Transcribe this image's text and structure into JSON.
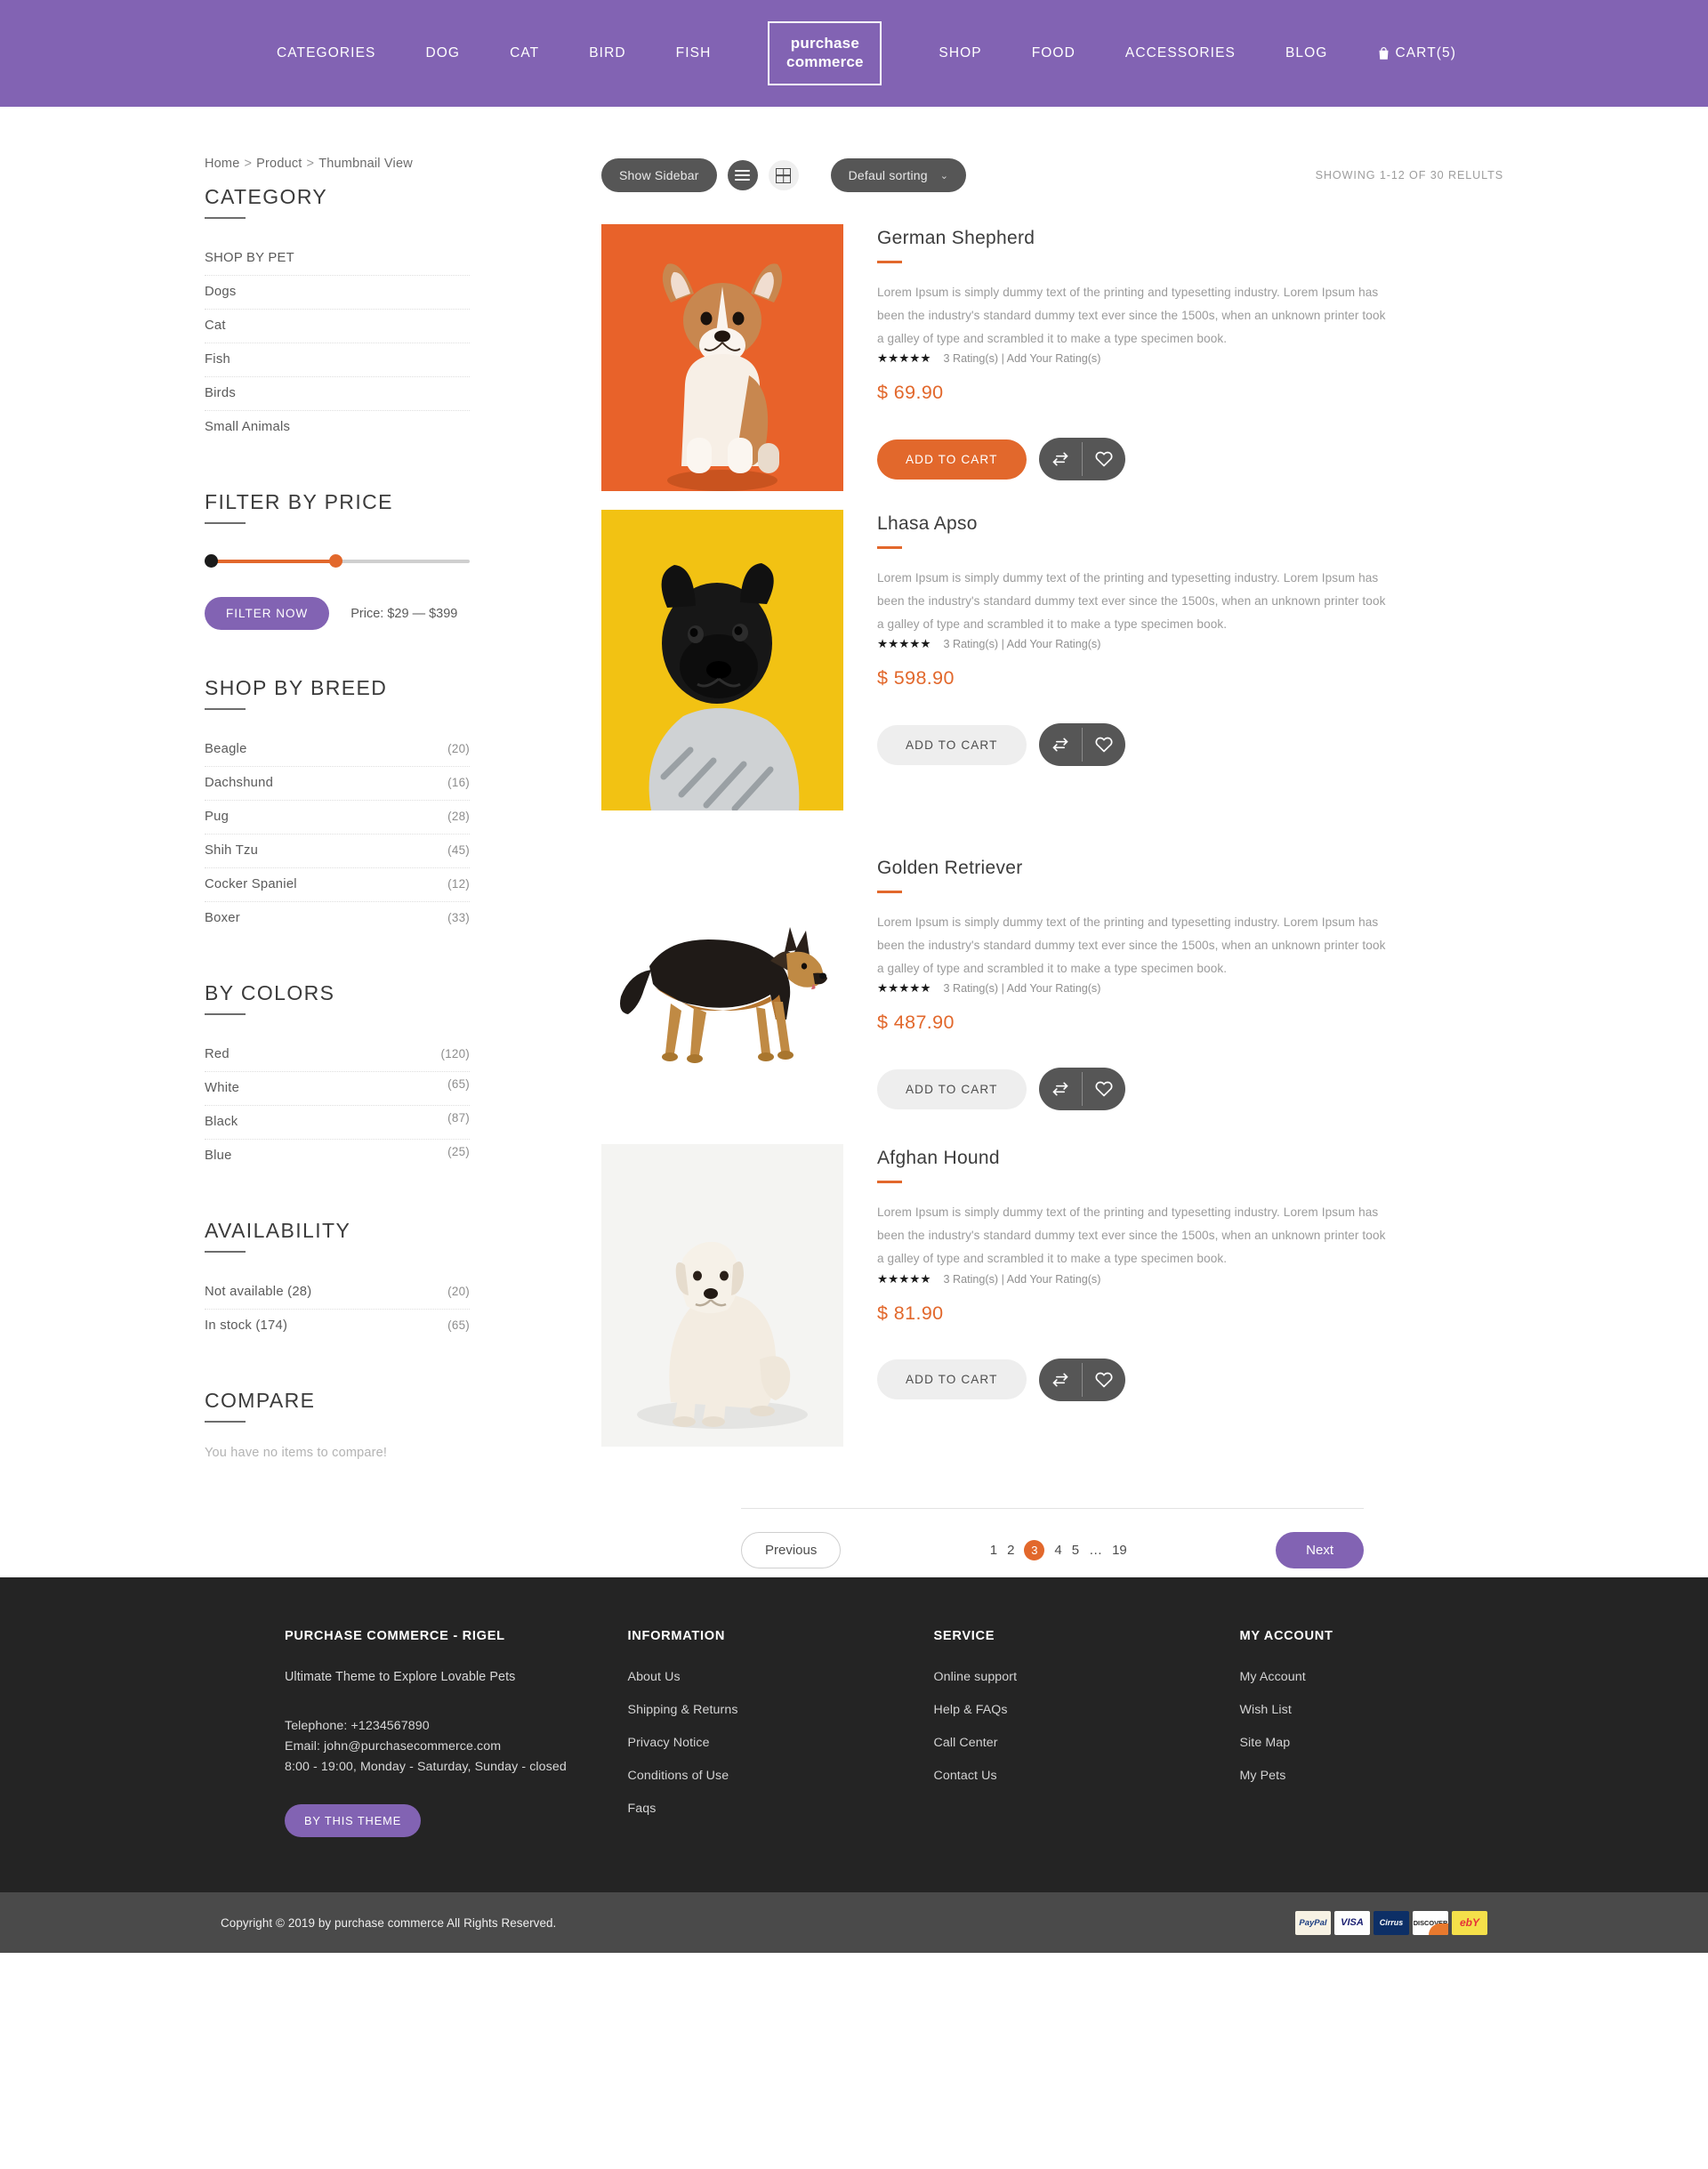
{
  "header": {
    "nav_left": [
      "CATEGORIES",
      "DOG",
      "CAT",
      "BIRD",
      "FISH"
    ],
    "logo_line1": "purchase",
    "logo_line2": "commerce",
    "nav_right": [
      "SHOP",
      "FOOD",
      "ACCESSORIES",
      "BLOG"
    ],
    "cart_label": "CART(5)",
    "cart_icon": "cart-icon",
    "brand_color": "#8263b3"
  },
  "breadcrumb": {
    "items": [
      "Home",
      "Product",
      "Thumbnail View"
    ],
    "separator": ">"
  },
  "sidebar": {
    "category": {
      "title": "CATEGORY",
      "items": [
        {
          "label": "SHOP BY PET",
          "count": ""
        },
        {
          "label": "Dogs",
          "count": ""
        },
        {
          "label": "Cat",
          "count": ""
        },
        {
          "label": "Fish",
          "count": ""
        },
        {
          "label": "Birds",
          "count": ""
        },
        {
          "label": "Small Animals",
          "count": ""
        }
      ]
    },
    "price": {
      "title": "FILTER BY PRICE",
      "filter_button": "FILTER NOW",
      "range_label": "Price: $29 — $399",
      "min": 29,
      "max": 399,
      "knob_low_color": "#1b1b1b",
      "knob_high_color": "#e2682c"
    },
    "breed": {
      "title": "SHOP BY BREED",
      "items": [
        {
          "label": "Beagle",
          "count": "(20)"
        },
        {
          "label": "Dachshund",
          "count": "(16)"
        },
        {
          "label": "Pug",
          "count": "(28)"
        },
        {
          "label": "Shih Tzu",
          "count": "(45)"
        },
        {
          "label": "Cocker Spaniel",
          "count": "(12)"
        },
        {
          "label": "Boxer",
          "count": "(33)"
        }
      ]
    },
    "colors": {
      "title": "BY COLORS",
      "items": [
        {
          "label": "Red",
          "count": "(120)"
        },
        {
          "label": "White",
          "count": "(65)"
        },
        {
          "label": "Black",
          "count": "(87)"
        },
        {
          "label": "Blue",
          "count": "(25)"
        }
      ]
    },
    "availability": {
      "title": "AVAILABILITY",
      "items": [
        {
          "label": "Not available (28)",
          "count": "(20)"
        },
        {
          "label": "In stock (174)",
          "count": "(65)"
        }
      ]
    },
    "compare": {
      "title": "COMPARE",
      "empty_text": "You have no items to compare!"
    }
  },
  "toolbar": {
    "show_sidebar_label": "Show Sidebar",
    "list_view_icon": "list-view-icon",
    "grid_view_icon": "grid-view-icon",
    "sort_label": "Defaul sorting",
    "sort_caret": "⌄",
    "results_text": "SHOWING 1-12 OF 30 RELULTS"
  },
  "products": [
    {
      "name": "German Shepherd",
      "description": "Lorem Ipsum is simply dummy text of the printing and typesetting industry. Lorem Ipsum has been the industry's standard dummy text ever since the 1500s, when an unknown printer took a galley of type and scrambled it to make a type specimen book.",
      "stars": "★★★★★",
      "rating_text": "3 Rating(s) | Add Your Rating(s)",
      "price": "$ 69.90",
      "cart_label": "ADD TO CART",
      "cart_style": "primary",
      "image": {
        "kind": "corgi-puppy",
        "bg": "#e8622a"
      },
      "compare_icon": "compare-arrows-icon",
      "wishlist_icon": "heart-icon"
    },
    {
      "name": "Lhasa Apso",
      "description": "Lorem Ipsum is simply dummy text of the printing and typesetting industry. Lorem Ipsum has been the industry's standard dummy text ever since the 1500s, when an unknown printer took a galley of type and scrambled it to make a type specimen book.",
      "stars": "★★★★★",
      "rating_text": "3 Rating(s) | Add Your Rating(s)",
      "price": "$ 598.90",
      "cart_label": "ADD TO CART",
      "cart_style": "muted",
      "image": {
        "kind": "black-pug",
        "bg": "#f2c213"
      },
      "compare_icon": "compare-arrows-icon",
      "wishlist_icon": "heart-icon"
    },
    {
      "name": "Golden Retriever",
      "description": "Lorem Ipsum is simply dummy text of the printing and typesetting industry. Lorem Ipsum has been the industry's standard dummy text ever since the 1500s, when an unknown printer took a galley of type and scrambled it to make a type specimen book.",
      "stars": "★★★★★",
      "rating_text": "3 Rating(s) | Add Your Rating(s)",
      "price": "$ 487.90",
      "cart_label": "ADD TO CART",
      "cart_style": "muted",
      "image": {
        "kind": "shepherd-standing",
        "bg": "#ffffff"
      },
      "compare_icon": "compare-arrows-icon",
      "wishlist_icon": "heart-icon"
    },
    {
      "name": "Afghan Hound",
      "description": "Lorem Ipsum is simply dummy text of the printing and typesetting industry. Lorem Ipsum has been the industry's standard dummy text ever since the 1500s, when an unknown printer took a galley of type and scrambled it to make a type specimen book.",
      "stars": "★★★★★",
      "rating_text": "3 Rating(s) | Add Your Rating(s)",
      "price": "$ 81.90",
      "cart_label": "ADD TO CART",
      "cart_style": "muted",
      "image": {
        "kind": "white-retriever",
        "bg": "#f4f4f2"
      },
      "compare_icon": "compare-arrows-icon",
      "wishlist_icon": "heart-icon"
    }
  ],
  "pagination": {
    "previous": "Previous",
    "next": "Next",
    "pages": [
      "1",
      "2",
      "3",
      "4",
      "5",
      "…",
      "19"
    ],
    "active": "3",
    "active_color": "#e2682c"
  },
  "footer": {
    "brand": {
      "heading": "PURCHASE COMMERCE - RIGEL",
      "tagline": "Ultimate Theme to Explore Lovable Pets",
      "telephone": "Telephone: +1234567890",
      "email": "Email: john@purchasecommerce.com",
      "hours": "8:00 - 19:00, Monday - Saturday, Sunday - closed",
      "theme_button": "BY THIS THEME"
    },
    "information": {
      "heading": "INFORMATION",
      "links": [
        "About Us",
        "Shipping & Returns",
        "Privacy Notice",
        "Conditions of Use",
        "Faqs"
      ]
    },
    "service": {
      "heading": "SERVICE",
      "links": [
        "Online support",
        "Help & FAQs",
        "Call Center",
        "Contact Us"
      ]
    },
    "account": {
      "heading": "MY ACCOUNT",
      "links": [
        "My Account",
        "Wish List",
        "Site Map",
        "My Pets"
      ]
    },
    "copyright": "Copyright © 2019 by purchase commerce All Rights Reserved.",
    "payments": [
      "PayPal",
      "VISA",
      "Cirrus",
      "DISCOVER",
      "ebY"
    ]
  }
}
